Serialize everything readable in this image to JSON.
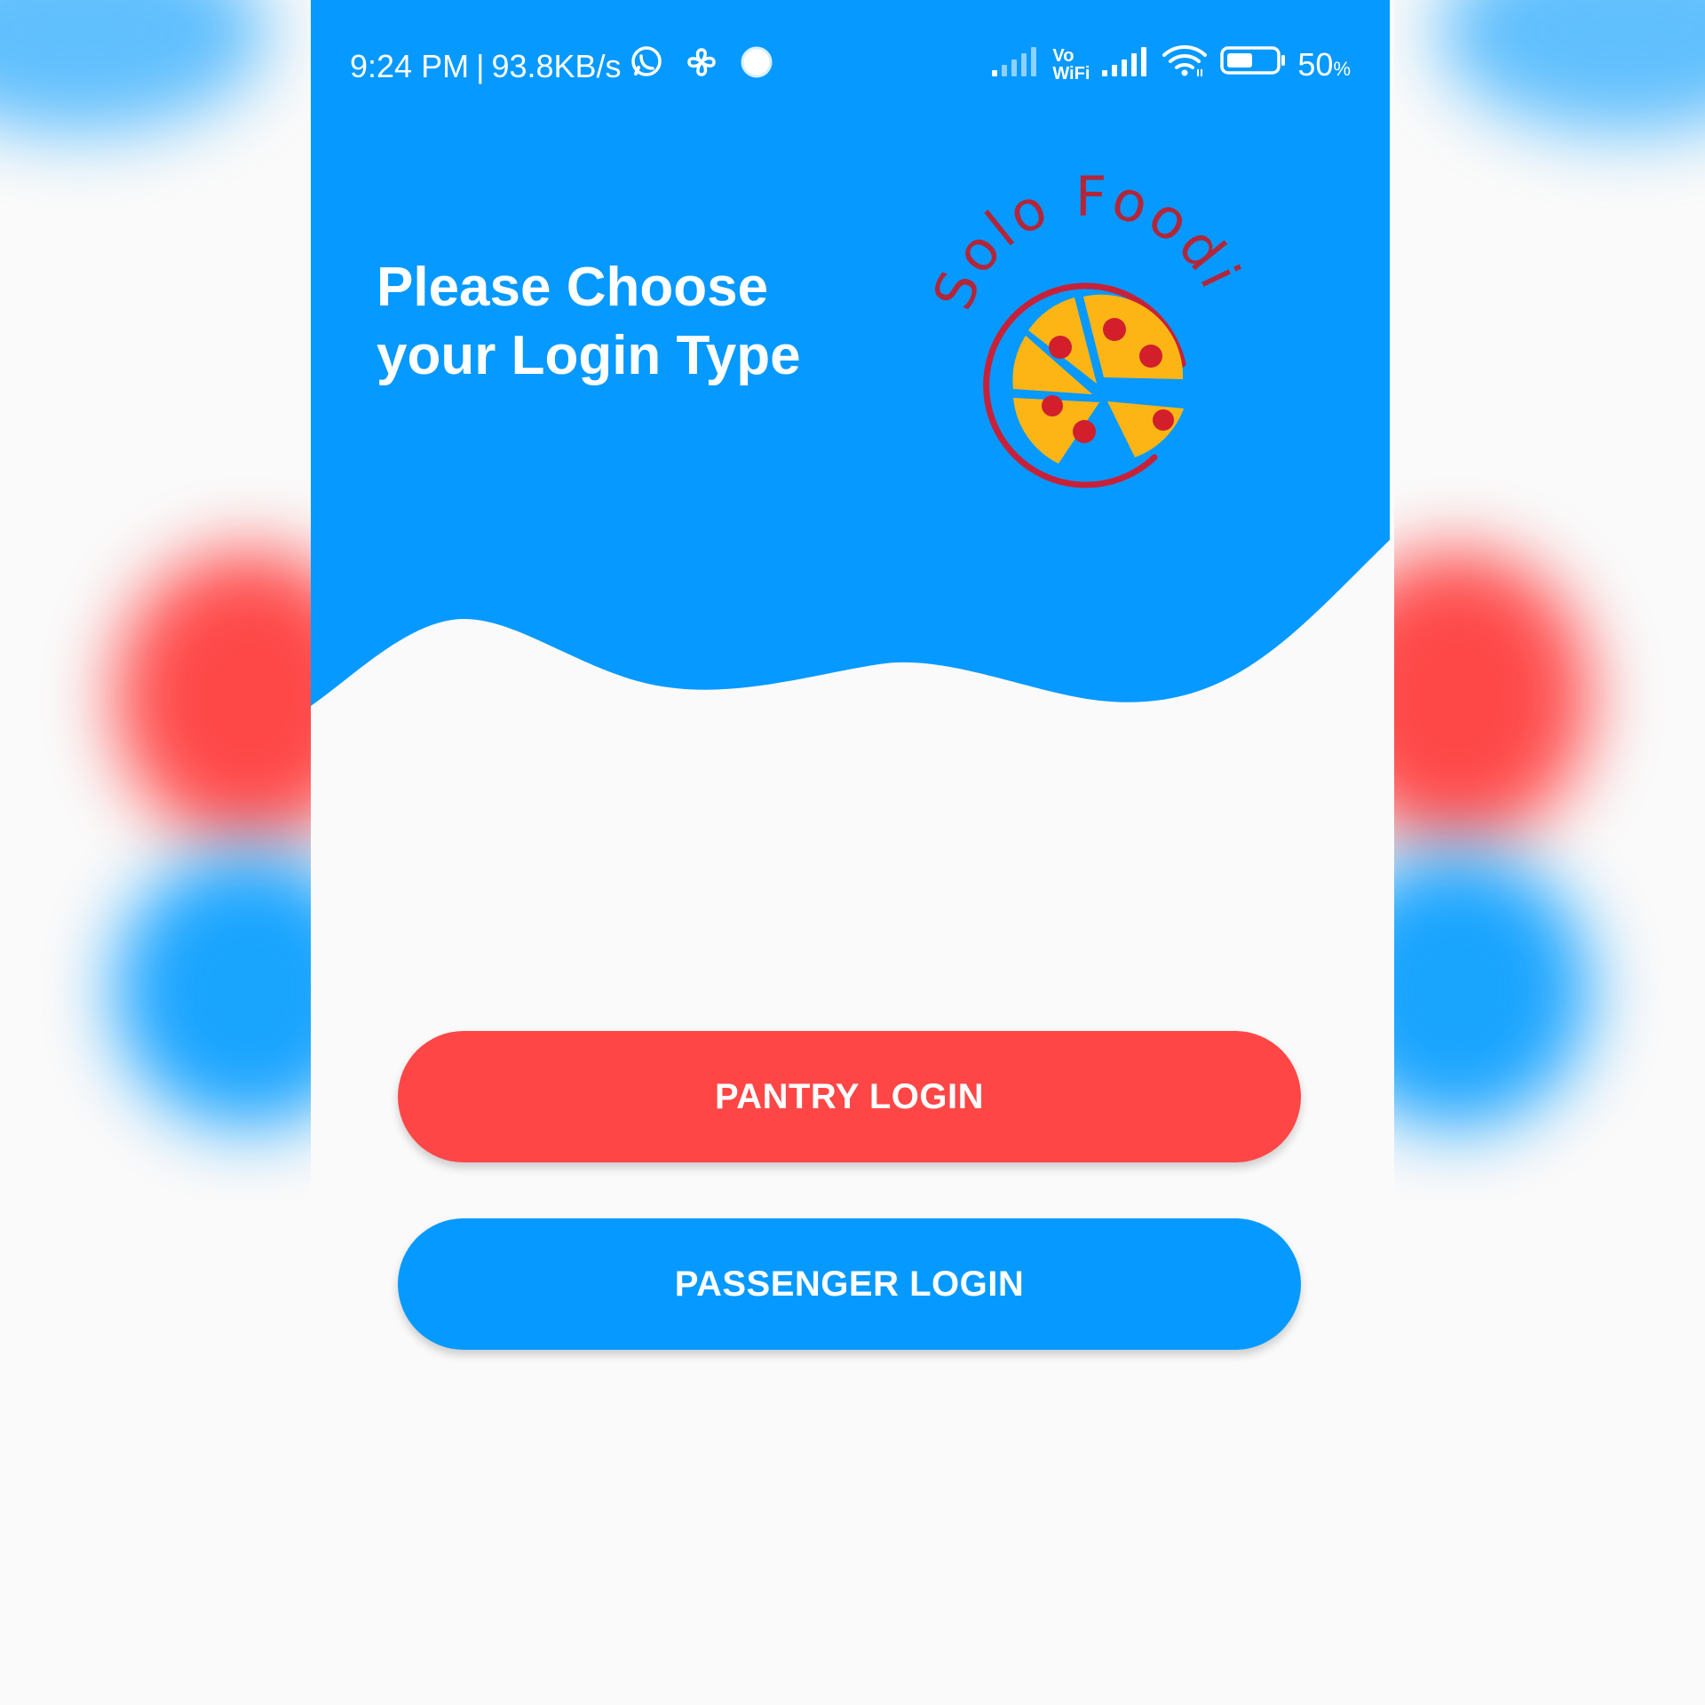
{
  "status_bar": {
    "time": "9:24 PM",
    "separator": "|",
    "network_speed": "93.8KB/s",
    "vowifi_top": "Vo",
    "vowifi_bottom": "WiFi",
    "battery_percent": "50",
    "battery_percent_sign": "%",
    "icons": [
      "whatsapp-icon",
      "pinwheel-icon",
      "circle-notification-icon",
      "signal-icon",
      "vowifi-icon",
      "signal-icon",
      "wifi-icon",
      "battery-icon"
    ]
  },
  "header": {
    "title_line1": "Please Choose",
    "title_line2": "your Login Type"
  },
  "logo": {
    "text": "Solo Foodie",
    "icon": "pizza-icon"
  },
  "buttons": {
    "pantry_label": "PANTRY LOGIN",
    "passenger_label": "PASSENGER LOGIN"
  },
  "colors": {
    "primary_blue": "#0699ff",
    "accent_red": "#ff4646",
    "background": "#fafafa",
    "logo_text": "#b2263a",
    "pizza_yellow": "#fdb515",
    "pepperoni": "#d21f2b"
  }
}
